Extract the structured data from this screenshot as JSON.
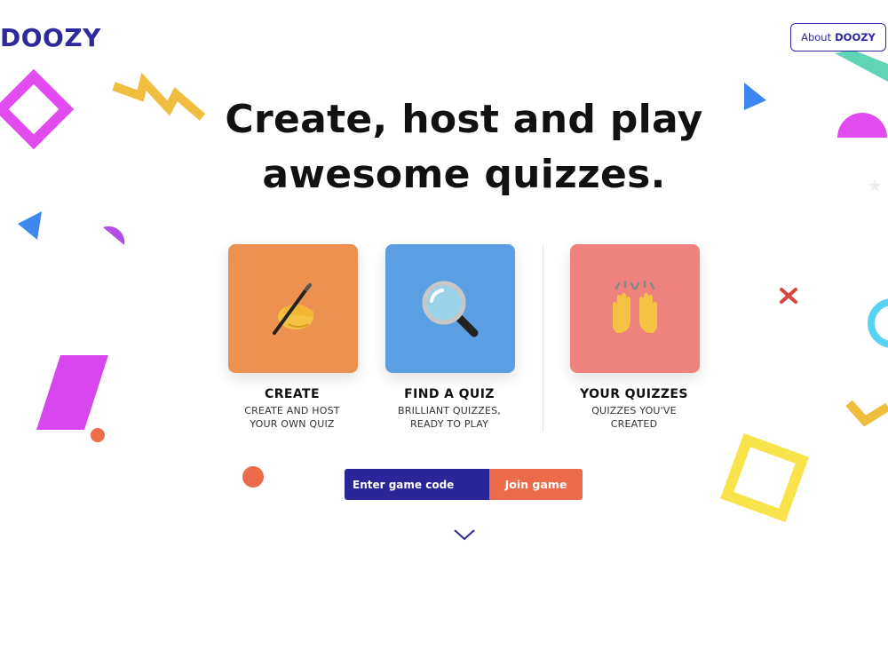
{
  "header": {
    "logo": "DOOZY",
    "about_prefix": "About",
    "about_brand": "DOOZY"
  },
  "hero": {
    "line1": "Create, host and play",
    "line2": "awesome quizzes."
  },
  "cards": [
    {
      "title": "CREATE",
      "sub1": "CREATE AND HOST",
      "sub2": "YOUR OWN QUIZ",
      "icon": "writing-hand-icon",
      "color": "#ec914f"
    },
    {
      "title": "FIND A QUIZ",
      "sub1": "BRILLIANT QUIZZES,",
      "sub2": "READY TO PLAY",
      "icon": "magnifying-glass-icon",
      "color": "#5b9fe3"
    },
    {
      "title": "YOUR QUIZZES",
      "sub1": "QUIZZES YOU'VE",
      "sub2": "CREATED",
      "icon": "raised-hands-icon",
      "color": "#ee837d"
    }
  ],
  "join": {
    "placeholder": "Enter game code",
    "value": "",
    "button": "Join game"
  },
  "colors": {
    "brand": "#2e2a9c",
    "join_input_bg": "#2a2599",
    "join_button_bg": "#ec6b4b"
  },
  "scroll": {
    "icon": "chevron-down-icon"
  }
}
